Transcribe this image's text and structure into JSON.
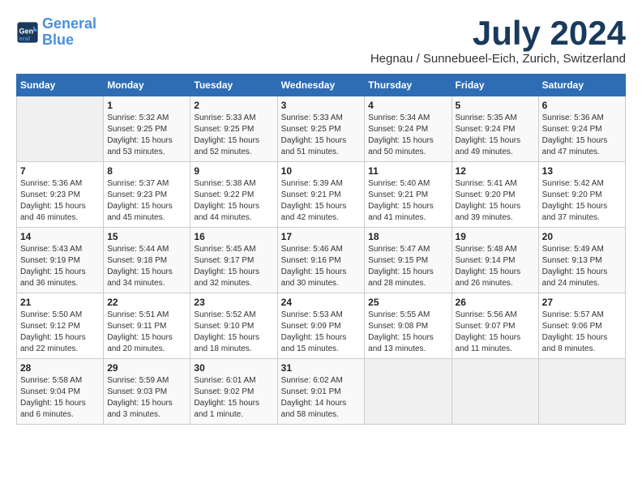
{
  "header": {
    "logo_line1": "General",
    "logo_line2": "Blue",
    "month_title": "July 2024",
    "subtitle": "Hegnau / Sunnebueel-Eich, Zurich, Switzerland"
  },
  "weekdays": [
    "Sunday",
    "Monday",
    "Tuesday",
    "Wednesday",
    "Thursday",
    "Friday",
    "Saturday"
  ],
  "weeks": [
    [
      {
        "day": "",
        "info": ""
      },
      {
        "day": "1",
        "info": "Sunrise: 5:32 AM\nSunset: 9:25 PM\nDaylight: 15 hours\nand 53 minutes."
      },
      {
        "day": "2",
        "info": "Sunrise: 5:33 AM\nSunset: 9:25 PM\nDaylight: 15 hours\nand 52 minutes."
      },
      {
        "day": "3",
        "info": "Sunrise: 5:33 AM\nSunset: 9:25 PM\nDaylight: 15 hours\nand 51 minutes."
      },
      {
        "day": "4",
        "info": "Sunrise: 5:34 AM\nSunset: 9:24 PM\nDaylight: 15 hours\nand 50 minutes."
      },
      {
        "day": "5",
        "info": "Sunrise: 5:35 AM\nSunset: 9:24 PM\nDaylight: 15 hours\nand 49 minutes."
      },
      {
        "day": "6",
        "info": "Sunrise: 5:36 AM\nSunset: 9:24 PM\nDaylight: 15 hours\nand 47 minutes."
      }
    ],
    [
      {
        "day": "7",
        "info": "Sunrise: 5:36 AM\nSunset: 9:23 PM\nDaylight: 15 hours\nand 46 minutes."
      },
      {
        "day": "8",
        "info": "Sunrise: 5:37 AM\nSunset: 9:23 PM\nDaylight: 15 hours\nand 45 minutes."
      },
      {
        "day": "9",
        "info": "Sunrise: 5:38 AM\nSunset: 9:22 PM\nDaylight: 15 hours\nand 44 minutes."
      },
      {
        "day": "10",
        "info": "Sunrise: 5:39 AM\nSunset: 9:21 PM\nDaylight: 15 hours\nand 42 minutes."
      },
      {
        "day": "11",
        "info": "Sunrise: 5:40 AM\nSunset: 9:21 PM\nDaylight: 15 hours\nand 41 minutes."
      },
      {
        "day": "12",
        "info": "Sunrise: 5:41 AM\nSunset: 9:20 PM\nDaylight: 15 hours\nand 39 minutes."
      },
      {
        "day": "13",
        "info": "Sunrise: 5:42 AM\nSunset: 9:20 PM\nDaylight: 15 hours\nand 37 minutes."
      }
    ],
    [
      {
        "day": "14",
        "info": "Sunrise: 5:43 AM\nSunset: 9:19 PM\nDaylight: 15 hours\nand 36 minutes."
      },
      {
        "day": "15",
        "info": "Sunrise: 5:44 AM\nSunset: 9:18 PM\nDaylight: 15 hours\nand 34 minutes."
      },
      {
        "day": "16",
        "info": "Sunrise: 5:45 AM\nSunset: 9:17 PM\nDaylight: 15 hours\nand 32 minutes."
      },
      {
        "day": "17",
        "info": "Sunrise: 5:46 AM\nSunset: 9:16 PM\nDaylight: 15 hours\nand 30 minutes."
      },
      {
        "day": "18",
        "info": "Sunrise: 5:47 AM\nSunset: 9:15 PM\nDaylight: 15 hours\nand 28 minutes."
      },
      {
        "day": "19",
        "info": "Sunrise: 5:48 AM\nSunset: 9:14 PM\nDaylight: 15 hours\nand 26 minutes."
      },
      {
        "day": "20",
        "info": "Sunrise: 5:49 AM\nSunset: 9:13 PM\nDaylight: 15 hours\nand 24 minutes."
      }
    ],
    [
      {
        "day": "21",
        "info": "Sunrise: 5:50 AM\nSunset: 9:12 PM\nDaylight: 15 hours\nand 22 minutes."
      },
      {
        "day": "22",
        "info": "Sunrise: 5:51 AM\nSunset: 9:11 PM\nDaylight: 15 hours\nand 20 minutes."
      },
      {
        "day": "23",
        "info": "Sunrise: 5:52 AM\nSunset: 9:10 PM\nDaylight: 15 hours\nand 18 minutes."
      },
      {
        "day": "24",
        "info": "Sunrise: 5:53 AM\nSunset: 9:09 PM\nDaylight: 15 hours\nand 15 minutes."
      },
      {
        "day": "25",
        "info": "Sunrise: 5:55 AM\nSunset: 9:08 PM\nDaylight: 15 hours\nand 13 minutes."
      },
      {
        "day": "26",
        "info": "Sunrise: 5:56 AM\nSunset: 9:07 PM\nDaylight: 15 hours\nand 11 minutes."
      },
      {
        "day": "27",
        "info": "Sunrise: 5:57 AM\nSunset: 9:06 PM\nDaylight: 15 hours\nand 8 minutes."
      }
    ],
    [
      {
        "day": "28",
        "info": "Sunrise: 5:58 AM\nSunset: 9:04 PM\nDaylight: 15 hours\nand 6 minutes."
      },
      {
        "day": "29",
        "info": "Sunrise: 5:59 AM\nSunset: 9:03 PM\nDaylight: 15 hours\nand 3 minutes."
      },
      {
        "day": "30",
        "info": "Sunrise: 6:01 AM\nSunset: 9:02 PM\nDaylight: 15 hours\nand 1 minute."
      },
      {
        "day": "31",
        "info": "Sunrise: 6:02 AM\nSunset: 9:01 PM\nDaylight: 14 hours\nand 58 minutes."
      },
      {
        "day": "",
        "info": ""
      },
      {
        "day": "",
        "info": ""
      },
      {
        "day": "",
        "info": ""
      }
    ]
  ]
}
